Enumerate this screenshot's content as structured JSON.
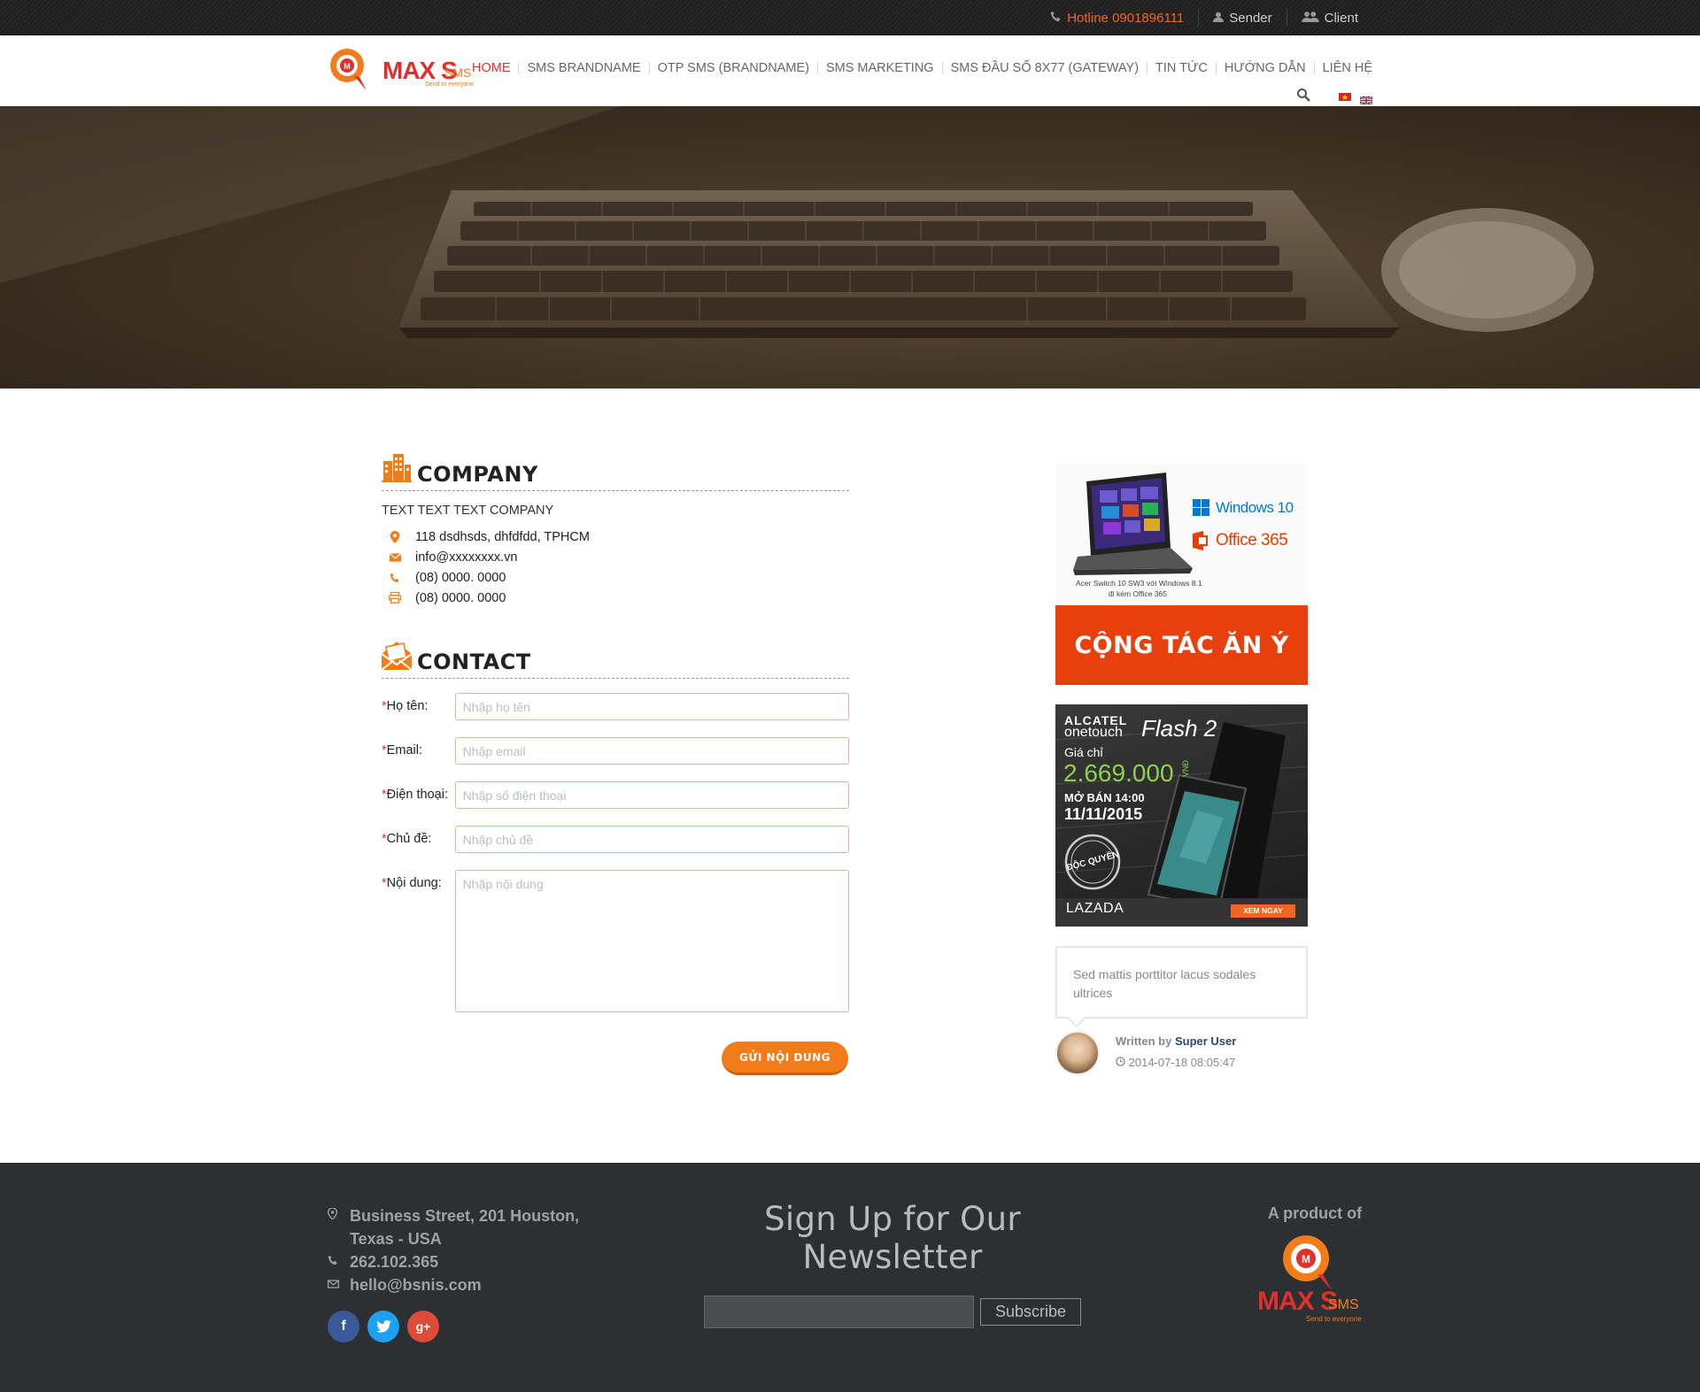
{
  "topbar": {
    "hotline": "Hotline 0901896111",
    "sender": "Sender",
    "client": "Client"
  },
  "header": {
    "logo_text": "MAX S",
    "logo_sms": "SMS",
    "logo_tagline": "Send to everyone",
    "nav": [
      {
        "label": "HOME",
        "active": true
      },
      {
        "label": "SMS BRANDNAME"
      },
      {
        "label": "OTP SMS (BRANDNAME)"
      },
      {
        "label": "SMS MARKETING"
      },
      {
        "label": "SMS ĐẦU SỐ 8X77 (GATEWAY)"
      },
      {
        "label": "TIN TỨC"
      },
      {
        "label": "HƯỚNG DẪN"
      },
      {
        "label": "LIÊN HỆ"
      }
    ]
  },
  "company": {
    "title": "COMPANY",
    "name": "TEXT TEXT TEXT COMPANY",
    "address": "118 dsdhsds, dhfdfdd, TPHCM",
    "email": "info@xxxxxxxx.vn",
    "phone": "(08) 0000. 0000",
    "fax": "(08) 0000. 0000"
  },
  "contact": {
    "title": "CONTACT",
    "fields": {
      "name": {
        "label": "Họ tên:",
        "placeholder": "Nhập họ tên"
      },
      "email": {
        "label": "Email:",
        "placeholder": "Nhập email"
      },
      "phone": {
        "label": "Điện thoại:",
        "placeholder": "Nhập số điện thoại"
      },
      "subject": {
        "label": "Chủ đề:",
        "placeholder": "Nhập chủ đề"
      },
      "message": {
        "label": "Nội dung:",
        "placeholder": "Nhập nội dung"
      }
    },
    "required_mark": "*",
    "submit_label": "GỬI NỘI DUNG"
  },
  "sidebar": {
    "ad1": {
      "windows": "Windows 10",
      "office": "Office 365",
      "caption1": "Acer Switch 10 SW3 với Windows 8.1",
      "caption2": "đi kèm Office 365",
      "banner": "CỘNG TÁC ĂN Ý"
    },
    "ad2": {
      "brand": "ALCATEL",
      "brand2": "onetouch",
      "model": "Flash 2",
      "price_label": "Giá chỉ",
      "price": "2.669.000",
      "currency": "VNĐ",
      "sale": "MỞ BÁN 14:00",
      "date": "11/11/2015",
      "badge": "ĐỘC QUYỀN",
      "shop": "LAZADA",
      "cta": "XEM NGAY"
    },
    "quote": {
      "text": "Sed mattis porttitor lacus sodales ultrices",
      "written_by": "Written by",
      "author": "Super User",
      "date": "2014-07-18 08:05:47"
    }
  },
  "footer": {
    "address1": "Business Street, 201 Houston,",
    "address2": "Texas - USA",
    "phone": "262.102.365",
    "email": "hello@bsnis.com",
    "newsletter_title": "Sign Up for Our Newsletter",
    "subscribe": "Subscribe",
    "product_of": "A product of"
  },
  "colors": {
    "accent": "#f27b1a",
    "active_nav": "#e0302c",
    "banner": "#e8400c",
    "footer_bg": "#2d3033"
  }
}
